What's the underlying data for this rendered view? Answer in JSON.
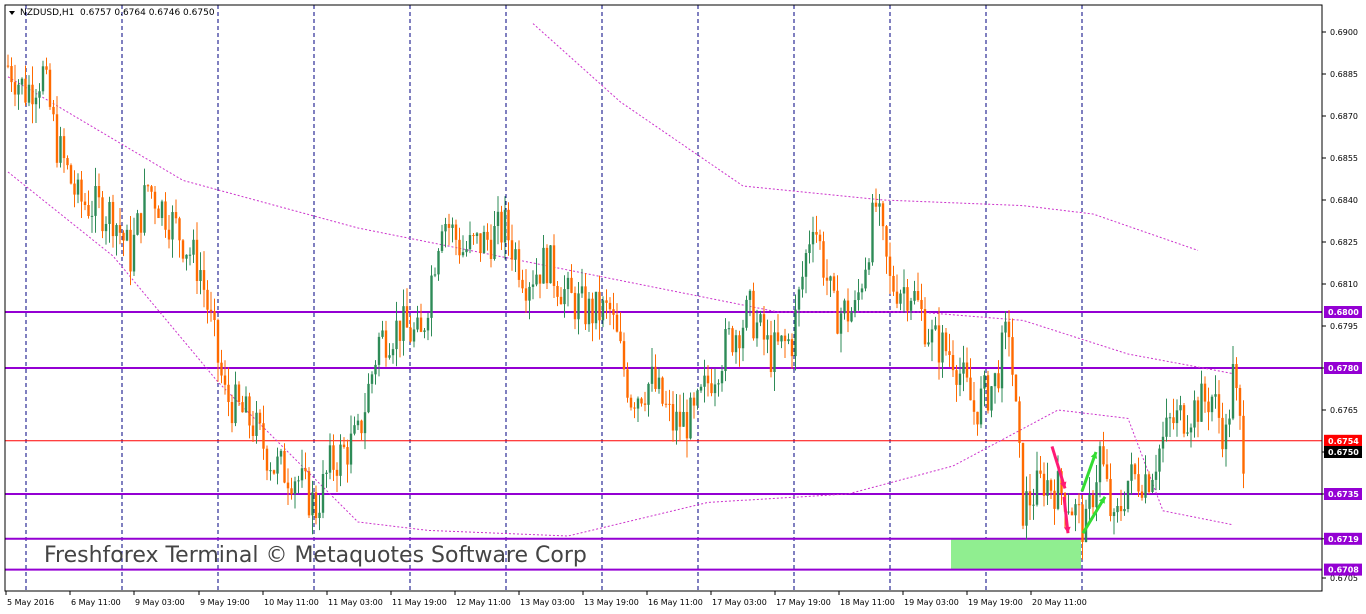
{
  "header": {
    "symbol_label": "NZDUSD,H1",
    "ohlc_label": "0.6757 0.6764 0.6746 0.6750"
  },
  "watermark": "Freshforex Terminal © Metaquotes Software Corp",
  "colors": {
    "background": "#ffffff",
    "frame": "#000000",
    "bull_candle": "#2e8b57",
    "bear_candle": "#ff6a00",
    "grid_dashed": "#000080",
    "level_line": "#9400d3",
    "current_price_line": "#ff0000",
    "envelope": "#cc33cc",
    "down_arrow": "#ff1a75",
    "up_arrow": "#33dd33",
    "target_zone": "#90ee90"
  },
  "chart_data": {
    "type": "candlestick",
    "title": "NZDUSD,H1",
    "ylim": [
      0.6703,
      0.69
    ],
    "y_ticks": [
      "0.6900",
      "0.6885",
      "0.6870",
      "0.6855",
      "0.6840",
      "0.6825",
      "0.6810",
      "0.6795",
      "0.6780",
      "0.6765",
      "0.6750",
      "0.6735",
      "0.6719",
      "0.6705"
    ],
    "x_ticks": [
      "5 May 2016",
      "6 May 11:00",
      "9 May 03:00",
      "9 May 19:00",
      "10 May 11:00",
      "11 May 03:00",
      "11 May 19:00",
      "12 May 11:00",
      "13 May 03:00",
      "13 May 19:00",
      "16 May 11:00",
      "17 May 03:00",
      "17 May 19:00",
      "18 May 11:00",
      "19 May 03:00",
      "19 May 19:00",
      "20 May 11:00"
    ],
    "horizontal_levels": [
      {
        "price": 0.68,
        "label": "0.6800"
      },
      {
        "price": 0.678,
        "label": "0.6780"
      },
      {
        "price": 0.6735,
        "label": "0.6735"
      },
      {
        "price": 0.6719,
        "label": "0.6719"
      },
      {
        "price": 0.6708,
        "label": "0.6708"
      }
    ],
    "current_price": {
      "price": 0.6754,
      "label": "0.6754"
    },
    "bid_price": {
      "price": 0.675,
      "label": "0.6750"
    },
    "forecast_zone": {
      "price_low": 0.6708,
      "price_high": 0.6719
    },
    "price_path_anchors": [
      {
        "bar": 0,
        "price": 0.6888
      },
      {
        "bar": 5,
        "price": 0.6879
      },
      {
        "bar": 10,
        "price": 0.6885
      },
      {
        "bar": 14,
        "price": 0.686
      },
      {
        "bar": 20,
        "price": 0.684
      },
      {
        "bar": 30,
        "price": 0.6835
      },
      {
        "bar": 35,
        "price": 0.682
      },
      {
        "bar": 40,
        "price": 0.6845
      },
      {
        "bar": 48,
        "price": 0.683
      },
      {
        "bar": 55,
        "price": 0.6815
      },
      {
        "bar": 62,
        "price": 0.677
      },
      {
        "bar": 70,
        "price": 0.676
      },
      {
        "bar": 76,
        "price": 0.6745
      },
      {
        "bar": 82,
        "price": 0.6742
      },
      {
        "bar": 88,
        "price": 0.673
      },
      {
        "bar": 92,
        "price": 0.6745
      },
      {
        "bar": 100,
        "price": 0.6755
      },
      {
        "bar": 106,
        "price": 0.679
      },
      {
        "bar": 112,
        "price": 0.6795
      },
      {
        "bar": 118,
        "price": 0.679
      },
      {
        "bar": 124,
        "price": 0.6835
      },
      {
        "bar": 130,
        "price": 0.6822
      },
      {
        "bar": 136,
        "price": 0.6825
      },
      {
        "bar": 142,
        "price": 0.683
      },
      {
        "bar": 148,
        "price": 0.6812
      },
      {
        "bar": 154,
        "price": 0.6818
      },
      {
        "bar": 160,
        "price": 0.6805
      },
      {
        "bar": 166,
        "price": 0.68
      },
      {
        "bar": 172,
        "price": 0.68
      },
      {
        "bar": 178,
        "price": 0.677
      },
      {
        "bar": 184,
        "price": 0.6775
      },
      {
        "bar": 190,
        "price": 0.676
      },
      {
        "bar": 196,
        "price": 0.6762
      },
      {
        "bar": 200,
        "price": 0.6775
      },
      {
        "bar": 206,
        "price": 0.679
      },
      {
        "bar": 212,
        "price": 0.68
      },
      {
        "bar": 218,
        "price": 0.6785
      },
      {
        "bar": 224,
        "price": 0.679
      },
      {
        "bar": 230,
        "price": 0.6835
      },
      {
        "bar": 236,
        "price": 0.68
      },
      {
        "bar": 242,
        "price": 0.68
      },
      {
        "bar": 248,
        "price": 0.6838
      },
      {
        "bar": 252,
        "price": 0.681
      },
      {
        "bar": 258,
        "price": 0.6808
      },
      {
        "bar": 264,
        "price": 0.679
      },
      {
        "bar": 270,
        "price": 0.6785
      },
      {
        "bar": 276,
        "price": 0.6765
      },
      {
        "bar": 282,
        "price": 0.6775
      },
      {
        "bar": 286,
        "price": 0.6795
      },
      {
        "bar": 290,
        "price": 0.673
      },
      {
        "bar": 296,
        "price": 0.674
      },
      {
        "bar": 302,
        "price": 0.6735
      },
      {
        "bar": 308,
        "price": 0.6722
      },
      {
        "bar": 312,
        "price": 0.675
      },
      {
        "bar": 316,
        "price": 0.6722
      },
      {
        "bar": 320,
        "price": 0.674
      },
      {
        "bar": 326,
        "price": 0.6742
      },
      {
        "bar": 332,
        "price": 0.676
      },
      {
        "bar": 338,
        "price": 0.6765
      },
      {
        "bar": 344,
        "price": 0.677
      },
      {
        "bar": 348,
        "price": 0.6755
      },
      {
        "bar": 350,
        "price": 0.6777
      },
      {
        "bar": 353,
        "price": 0.675
      }
    ],
    "envelope_upper": [
      {
        "bar": 150,
        "price": 0.6903
      },
      {
        "bar": 175,
        "price": 0.6875
      },
      {
        "bar": 210,
        "price": 0.6845
      },
      {
        "bar": 250,
        "price": 0.684
      },
      {
        "bar": 290,
        "price": 0.6838
      },
      {
        "bar": 310,
        "price": 0.6835
      },
      {
        "bar": 340,
        "price": 0.6822
      }
    ],
    "envelope_middle": [
      {
        "bar": 0,
        "price": 0.6884
      },
      {
        "bar": 50,
        "price": 0.6847
      },
      {
        "bar": 100,
        "price": 0.683
      },
      {
        "bar": 160,
        "price": 0.6815
      },
      {
        "bar": 220,
        "price": 0.68
      },
      {
        "bar": 260,
        "price": 0.68
      },
      {
        "bar": 290,
        "price": 0.6797
      },
      {
        "bar": 320,
        "price": 0.6785
      },
      {
        "bar": 350,
        "price": 0.6778
      }
    ],
    "envelope_lower": [
      {
        "bar": 0,
        "price": 0.685
      },
      {
        "bar": 30,
        "price": 0.682
      },
      {
        "bar": 60,
        "price": 0.6775
      },
      {
        "bar": 100,
        "price": 0.6725
      },
      {
        "bar": 120,
        "price": 0.6722
      },
      {
        "bar": 160,
        "price": 0.672
      },
      {
        "bar": 200,
        "price": 0.6732
      },
      {
        "bar": 240,
        "price": 0.6735
      },
      {
        "bar": 270,
        "price": 0.6745
      },
      {
        "bar": 300,
        "price": 0.6765
      },
      {
        "bar": 320,
        "price": 0.6762
      },
      {
        "bar": 330,
        "price": 0.6729
      },
      {
        "bar": 350,
        "price": 0.6724
      }
    ],
    "forecast_arrows": [
      {
        "direction": "down",
        "from_price": 0.6752,
        "to_price": 0.6737
      },
      {
        "direction": "up",
        "from_price": 0.6736,
        "to_price": 0.675
      },
      {
        "direction": "down",
        "from_price": 0.6734,
        "to_price": 0.6721
      },
      {
        "direction": "up",
        "from_price": 0.6721,
        "to_price": 0.6734
      }
    ],
    "grid": "vertical dashed separators"
  }
}
